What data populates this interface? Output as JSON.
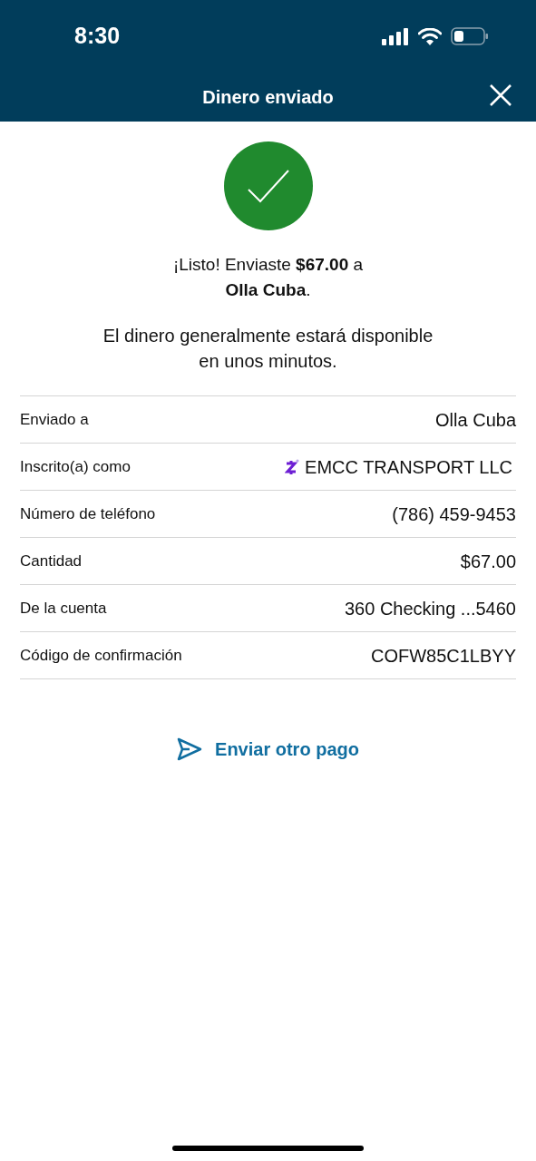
{
  "status_bar": {
    "time": "8:30"
  },
  "header": {
    "title": "Dinero enviado"
  },
  "success": {
    "message": "¡Listo! Enviaste **$67.00** a\n**Olla Cuba**.",
    "note": "El dinero generalmente estará disponible\nen unos minutos."
  },
  "details": [
    {
      "label": "Enviado a",
      "value": "Olla Cuba",
      "kind": "text"
    },
    {
      "label": "Inscrito(a) como",
      "value": "EMCC TRANSPORT LLC",
      "kind": "zelle"
    },
    {
      "label": "Número de teléfono",
      "value": "(786) 459-9453",
      "kind": "text"
    },
    {
      "label": "Cantidad",
      "value": "$67.00",
      "kind": "text"
    },
    {
      "label": "De la cuenta",
      "value": "360 Checking ...5460",
      "kind": "text"
    },
    {
      "label": "Código de confirmación",
      "value": "COFW85C1LBYY",
      "kind": "text"
    }
  ],
  "action": {
    "label": "Enviar otro pago"
  }
}
